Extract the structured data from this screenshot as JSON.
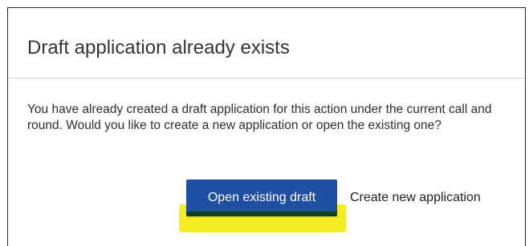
{
  "dialog": {
    "title": "Draft application already exists",
    "body": "You have already created a draft application for this action under the current call and round. Would you like to create a new application or open the existing one?",
    "primary_button_label": "Open existing draft",
    "secondary_button_label": "Create new application"
  },
  "colors": {
    "primary_button": "#1f4fa0",
    "highlight": "#f5ec26",
    "border": "#2b2b2b"
  }
}
